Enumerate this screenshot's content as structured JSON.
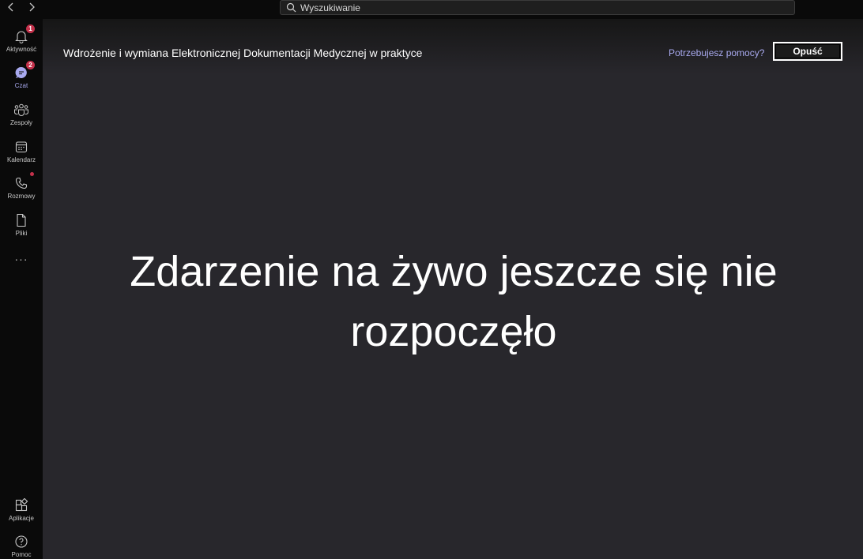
{
  "titlebar": {
    "search": {
      "placeholder": "Wyszukiwanie",
      "icon": "search-icon"
    },
    "back_icon": "chevron-left-icon",
    "forward_icon": "chevron-right-icon"
  },
  "rail": {
    "items": [
      {
        "id": "activity",
        "label": "Aktywność",
        "icon": "bell-icon",
        "badge": "1"
      },
      {
        "id": "chat",
        "label": "Czat",
        "icon": "chat-icon",
        "badge": "2",
        "active": true
      },
      {
        "id": "teams",
        "label": "Zespoły",
        "icon": "teams-icon"
      },
      {
        "id": "calendar",
        "label": "Kalendarz",
        "icon": "calendar-icon"
      },
      {
        "id": "calls",
        "label": "Rozmowy",
        "icon": "phone-icon"
      },
      {
        "id": "files",
        "label": "Pliki",
        "icon": "file-icon"
      }
    ],
    "more": "···",
    "bottom": [
      {
        "id": "apps",
        "label": "Aplikacje",
        "icon": "apps-icon"
      },
      {
        "id": "help",
        "label": "Pomoc",
        "icon": "help-icon"
      }
    ]
  },
  "colors": {
    "accent": "#a9aaf0",
    "badge": "#c4314b",
    "background": "#28272c"
  },
  "event": {
    "title": "Wdrożenie i wymiana Elektronicznej Dokumentacji Medycznej w praktyce",
    "help_link": "Potrzebujesz pomocy?",
    "leave_button": "Opuść",
    "status": "Zdarzenie na żywo jeszcze się nie rozpoczęło"
  }
}
